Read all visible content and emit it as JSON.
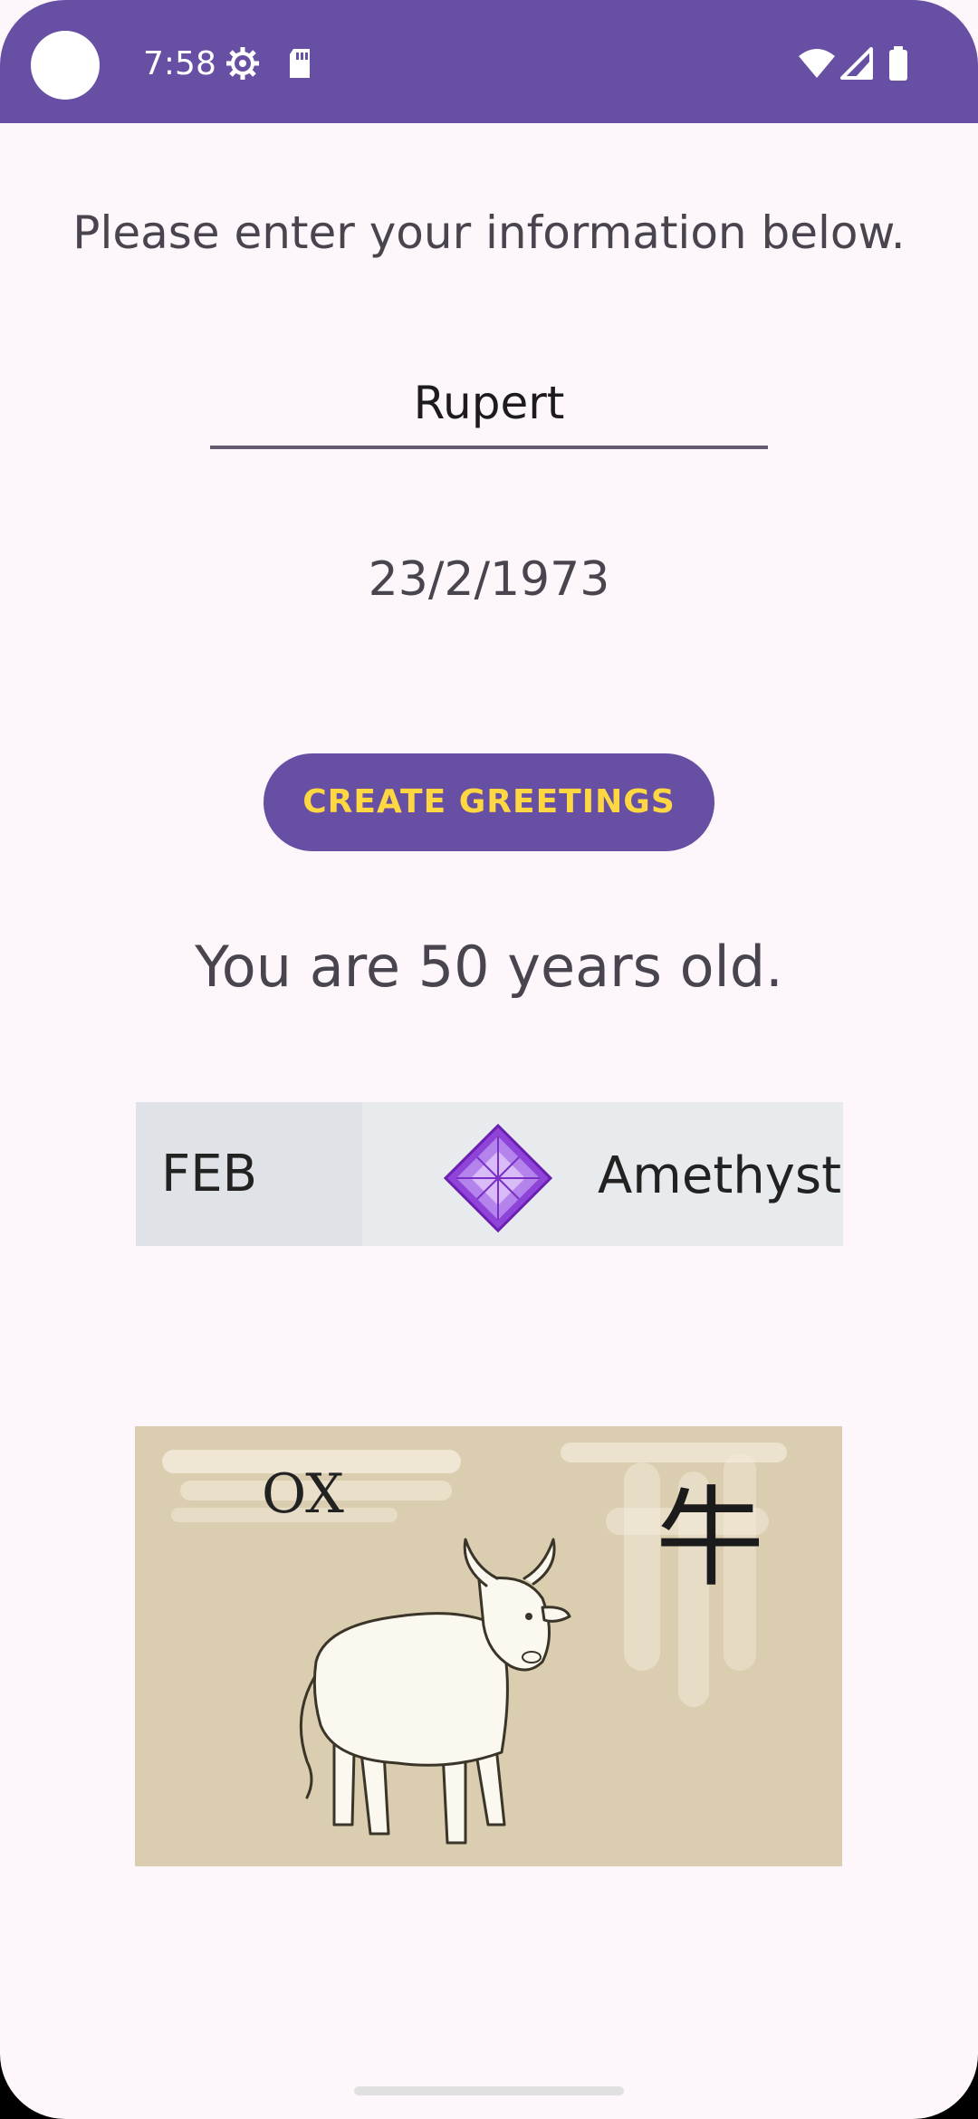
{
  "status_bar": {
    "time": "7:58",
    "left_icons": [
      "settings-gear-icon",
      "sd-card-icon"
    ],
    "right_icons": [
      "wifi-icon",
      "cell-signal-icon",
      "battery-icon"
    ],
    "background_color": "#6750a4"
  },
  "form": {
    "prompt": "Please enter your information below.",
    "name_value": "Rupert",
    "birth_date": "23/2/1973",
    "button_label": "CREATE GREETINGS"
  },
  "result": {
    "age_text": "You are 50 years old.",
    "birthstone": {
      "month": "FEB",
      "stone": "Amethyst",
      "icon": "amethyst-gem-icon"
    },
    "zodiac": {
      "sign": "OX",
      "kanji": "牛",
      "illustration": "ox-illustration"
    }
  },
  "colors": {
    "primary": "#6750a4",
    "button_text": "#ffd740",
    "background": "#fdf7fb"
  }
}
